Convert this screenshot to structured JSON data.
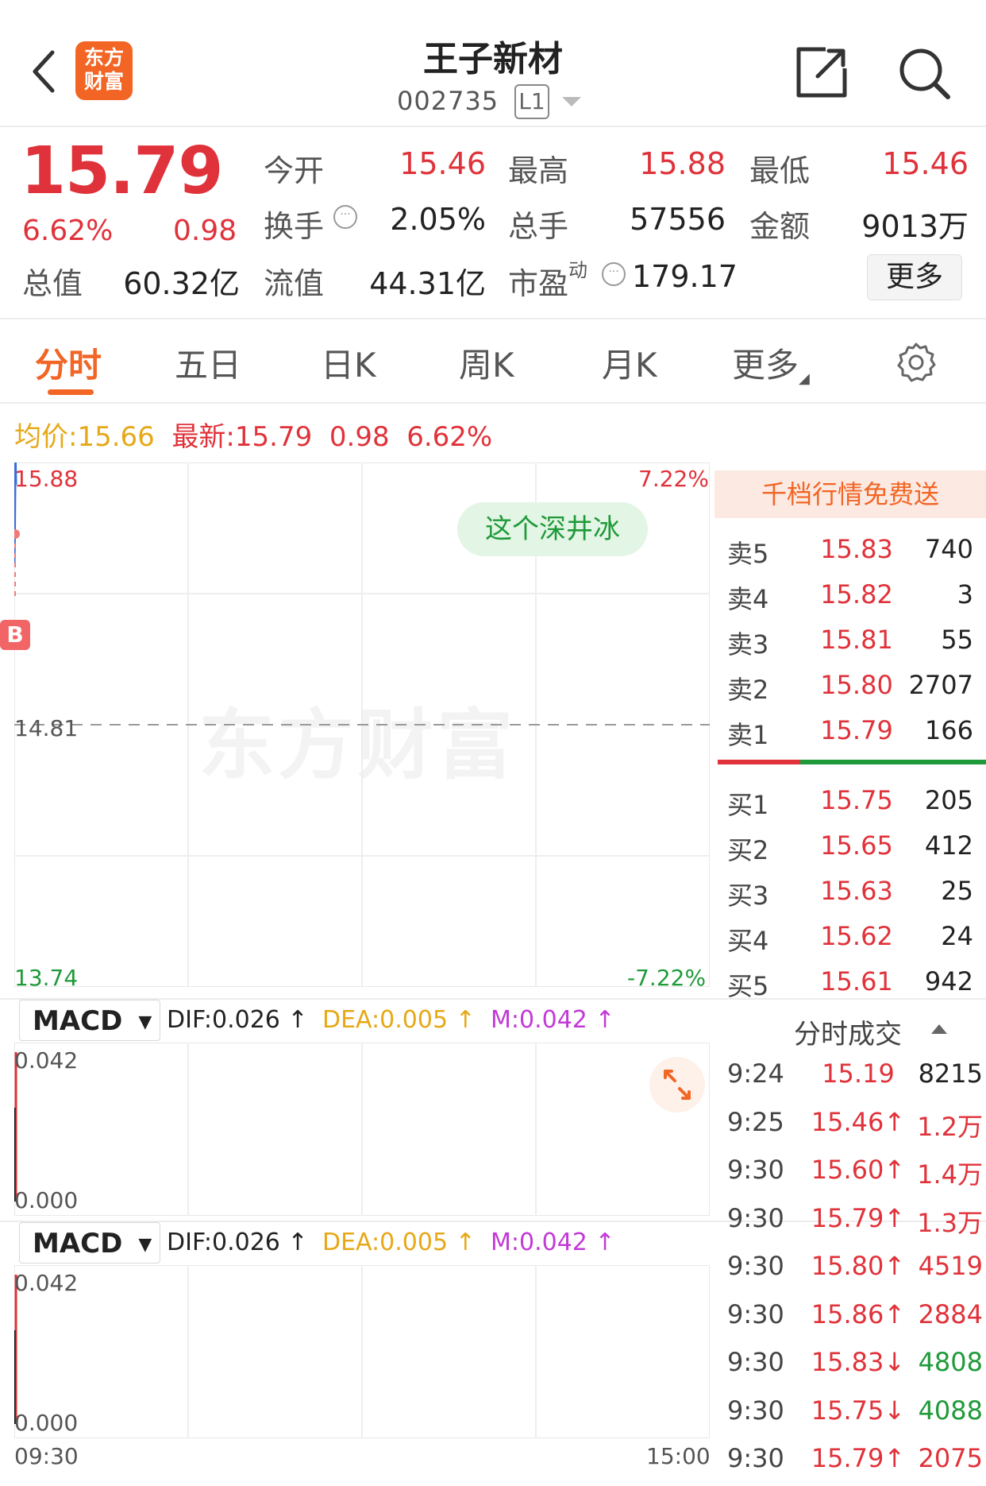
{
  "header": {
    "logo_line1": "东方",
    "logo_line2": "财富",
    "stock_name": "王子新材",
    "stock_code": "002735",
    "level_badge": "L1"
  },
  "quote": {
    "price": "15.79",
    "change_pct": "6.62%",
    "change": "0.98",
    "open_label": "今开",
    "open": "15.46",
    "high_label": "最高",
    "high": "15.88",
    "low_label": "最低",
    "low": "15.46",
    "turnover_label": "换手",
    "turnover": "2.05%",
    "volume_label": "总手",
    "volume": "57556",
    "amount_label": "金额",
    "amount": "9013万",
    "mktcap_label": "总值",
    "mktcap": "60.32亿",
    "float_label": "流值",
    "float_cap": "44.31亿",
    "pe_label": "市盈",
    "pe_sup": "动",
    "pe": "179.17",
    "more_label": "更多"
  },
  "tabs": [
    "分时",
    "五日",
    "日K",
    "周K",
    "月K",
    "更多"
  ],
  "avg_line": {
    "avg_label": "均价:",
    "avg": "15.66",
    "latest_label": "最新:",
    "latest": "15.79",
    "change": "0.98",
    "change_pct": "6.62%"
  },
  "chart_data": {
    "type": "line",
    "title": "",
    "xlabel": "",
    "ylabel": "",
    "x_ticks": [
      "09:30",
      "15:00"
    ],
    "y_max": "15.88",
    "y_mid": "14.81",
    "y_min": "13.74",
    "pct_max": "7.22%",
    "pct_min": "-7.22%",
    "ylim": [
      13.74,
      15.88
    ],
    "series": [
      {
        "values": [
          15.46,
          15.6,
          15.79,
          15.88,
          15.79
        ]
      }
    ],
    "bubble_text": "这个深井冰",
    "watermark": "东方财富",
    "marker": "B",
    "accent_colors": {
      "up": "#e0323a",
      "down": "#1f9a3a",
      "line": "#3a6fd8"
    }
  },
  "macd_panels": [
    {
      "selector": "MACD",
      "dif": "DIF:0.026 ↑",
      "dea": "DEA:0.005 ↑",
      "m": "M:0.042 ↑",
      "top": "0.042",
      "bottom": "0.000"
    },
    {
      "selector": "MACD",
      "dif": "DIF:0.026 ↑",
      "dea": "DEA:0.005 ↑",
      "m": "M:0.042 ↑",
      "top": "0.042",
      "bottom": "0.000"
    }
  ],
  "order_book": {
    "header": "千档行情免费送",
    "asks": [
      {
        "label": "卖5",
        "price": "15.83",
        "vol": "740"
      },
      {
        "label": "卖4",
        "price": "15.82",
        "vol": "3"
      },
      {
        "label": "卖3",
        "price": "15.81",
        "vol": "55"
      },
      {
        "label": "卖2",
        "price": "15.80",
        "vol": "2707"
      },
      {
        "label": "卖1",
        "price": "15.79",
        "vol": "166"
      }
    ],
    "bids": [
      {
        "label": "买1",
        "price": "15.75",
        "vol": "205"
      },
      {
        "label": "买2",
        "price": "15.65",
        "vol": "412"
      },
      {
        "label": "买3",
        "price": "15.63",
        "vol": "25"
      },
      {
        "label": "买4",
        "price": "15.62",
        "vol": "24"
      },
      {
        "label": "买5",
        "price": "15.61",
        "vol": "942"
      }
    ]
  },
  "ticks": {
    "header": "分时成交",
    "rows": [
      {
        "time": "9:24",
        "price": "15.19",
        "vol": "8215",
        "dir": ""
      },
      {
        "time": "9:25",
        "price": "15.46↑",
        "vol": "1.2万",
        "dir": "up"
      },
      {
        "time": "9:30",
        "price": "15.60↑",
        "vol": "1.4万",
        "dir": "up"
      },
      {
        "time": "9:30",
        "price": "15.79↑",
        "vol": "1.3万",
        "dir": "up"
      },
      {
        "time": "9:30",
        "price": "15.80↑",
        "vol": "4519",
        "dir": "up"
      },
      {
        "time": "9:30",
        "price": "15.86↑",
        "vol": "2884",
        "dir": "up"
      },
      {
        "time": "9:30",
        "price": "15.83↓",
        "vol": "4808",
        "dir": "down"
      },
      {
        "time": "9:30",
        "price": "15.75↓",
        "vol": "4088",
        "dir": "down"
      },
      {
        "time": "9:30",
        "price": "15.79↑",
        "vol": "2075",
        "dir": "up"
      }
    ]
  }
}
